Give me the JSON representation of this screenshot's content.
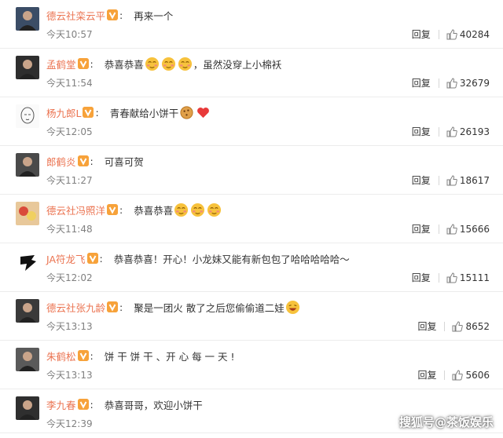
{
  "comments": [
    {
      "user": "德云社栾云平",
      "badge": "V",
      "text": "再来一个",
      "emojis": [],
      "after_text": "",
      "time": "今天10:57",
      "reply": "回复",
      "likes": "40284",
      "avatar": "avatar-photo"
    },
    {
      "user": "孟鹤堂",
      "badge": "V",
      "text": "恭喜恭喜",
      "emojis": [
        "blush",
        "blush",
        "blush"
      ],
      "after_text": "，虽然没穿上小棉袄",
      "time": "今天11:54",
      "reply": "回复",
      "likes": "32679",
      "avatar": "avatar-photo"
    },
    {
      "user": "杨九郎L",
      "badge": "V",
      "text": "青春献给小饼干",
      "emojis": [
        "cookie",
        "heart"
      ],
      "after_text": "",
      "time": "今天12:05",
      "reply": "回复",
      "likes": "26193",
      "avatar": "avatar-sketch"
    },
    {
      "user": "郎鹤炎",
      "badge": "V",
      "text": "可喜可贺",
      "emojis": [],
      "after_text": "",
      "time": "今天11:27",
      "reply": "回复",
      "likes": "18617",
      "avatar": "avatar-photo"
    },
    {
      "user": "德云社冯照洋",
      "badge": "V",
      "text": "恭喜恭喜",
      "emojis": [
        "blush",
        "blush",
        "blush"
      ],
      "after_text": "",
      "time": "今天11:48",
      "reply": "回复",
      "likes": "15666",
      "avatar": "avatar-painting"
    },
    {
      "user": "JA符龙飞",
      "badge": "V",
      "text": "恭喜恭喜！开心！小龙妹又能有新包包了哈哈哈哈哈～",
      "emojis": [],
      "after_text": "",
      "time": "今天12:02",
      "reply": "回复",
      "likes": "15111",
      "avatar": "avatar-logo"
    },
    {
      "user": "德云社张九龄",
      "badge": "V",
      "text": "聚是一团火 散了之后您偷偷道二娃",
      "emojis": [
        "laugh"
      ],
      "after_text": "",
      "time": "今天13:13",
      "reply": "回复",
      "likes": "8652",
      "avatar": "avatar-photo"
    },
    {
      "user": "朱鹤松",
      "badge": "V",
      "text": "饼 干 饼 干 、开 心 每 一 天 !",
      "emojis": [],
      "after_text": "",
      "time": "今天13:13",
      "reply": "回复",
      "likes": "5606",
      "avatar": "avatar-photo"
    },
    {
      "user": "李九春",
      "badge": "V",
      "text": "恭喜哥哥，欢迎小饼干",
      "emojis": [],
      "after_text": "",
      "time": "今天12:39",
      "reply": "",
      "likes": "",
      "avatar": "avatar-photo"
    }
  ],
  "watermark": "搜狐号@茶饭娱乐",
  "colors": {
    "username": "#eb7350",
    "badge": "#f7a23a",
    "time": "#808080",
    "text": "#333333"
  }
}
